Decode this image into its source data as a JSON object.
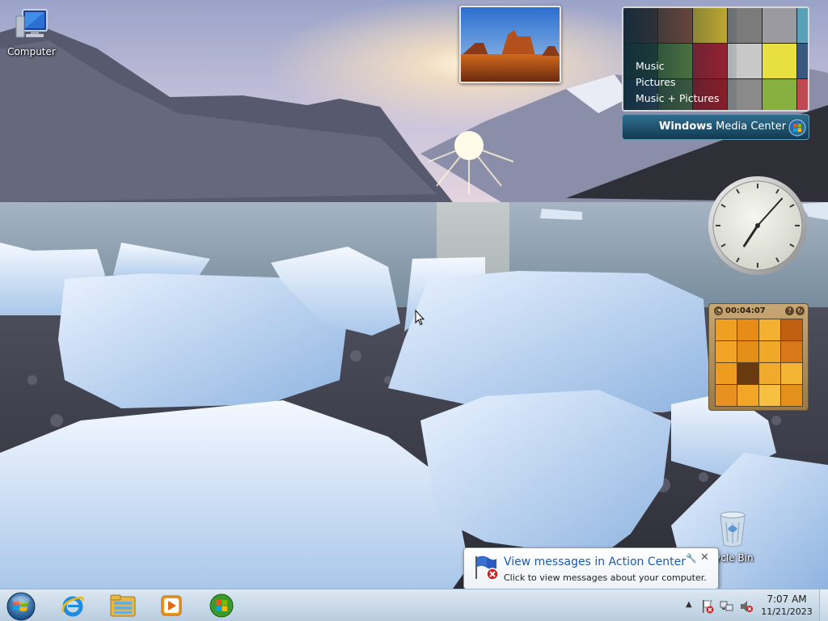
{
  "desktop": {
    "icons": [
      {
        "label": "Computer",
        "icon": "computer-icon"
      },
      {
        "label": "Recycle Bin",
        "icon": "recycle-bin-icon"
      }
    ]
  },
  "gadgets": {
    "slideshow": {
      "icon": "slideshow-image"
    },
    "media_center": {
      "menu": [
        "Music",
        "Pictures",
        "Music + Pictures"
      ],
      "title_bold": "Windows",
      "title_rest": " Media Center"
    },
    "clock": {
      "hour": 7,
      "minute": 7
    },
    "puzzle": {
      "timer": "00:04:07"
    }
  },
  "notification": {
    "title": "View messages in Action Center",
    "text": "Click to view messages about your computer."
  },
  "taskbar": {
    "pinned": [
      "internet-explorer-icon",
      "windows-explorer-icon",
      "media-player-icon",
      "media-center-icon"
    ],
    "time": "7:07 AM",
    "date": "11/21/2023"
  },
  "colors": {
    "taskbar": "#c8d9e8",
    "balloon_title": "#1e5ab4",
    "media_center_bar": "#1f5470"
  }
}
